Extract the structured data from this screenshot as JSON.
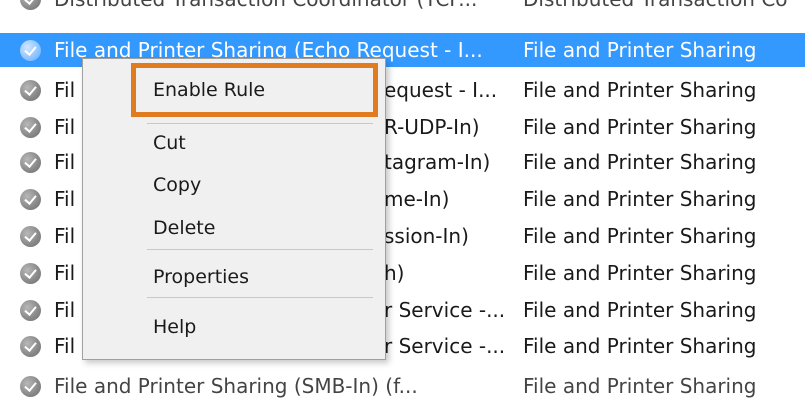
{
  "top_row": {
    "name": "Distributed Transaction Coordinator (TCP...",
    "group": "Distributed Transaction Co"
  },
  "rows": [
    {
      "name": "File and Printer Sharing (Echo Request - I...",
      "group": "File and Printer Sharing",
      "selected": true
    },
    {
      "name": "Fil",
      "name_tail": "equest - I...",
      "group": "File and Printer Sharing"
    },
    {
      "name": "Fil",
      "name_tail": "R-UDP-In)",
      "group": "File and Printer Sharing"
    },
    {
      "name": "Fil",
      "name_tail": "tagram-In)",
      "group": "File and Printer Sharing"
    },
    {
      "name": "Fil",
      "name_tail": "me-In)",
      "group": "File and Printer Sharing"
    },
    {
      "name": "Fil",
      "name_tail": "ssion-In)",
      "group": "File and Printer Sharing"
    },
    {
      "name": "Fil",
      "name_tail": "h)",
      "group": "File and Printer Sharing"
    },
    {
      "name": "Fil",
      "name_tail": "r Service -...",
      "group": "File and Printer Sharing"
    },
    {
      "name": "Fil",
      "name_tail": "r Service -...",
      "group": "File and Printer Sharing"
    }
  ],
  "bottom_row": {
    "name": "File and Printer Sharing (SMB-In) (f...",
    "group": "File and Printer Sharing"
  },
  "context_menu": {
    "enable_rule": "Enable Rule",
    "cut": "Cut",
    "copy": "Copy",
    "delete": "Delete",
    "properties": "Properties",
    "help": "Help"
  },
  "colors": {
    "selection": "#3399ff",
    "highlight_border": "#e07b20",
    "menu_background": "#f0f0f0"
  }
}
